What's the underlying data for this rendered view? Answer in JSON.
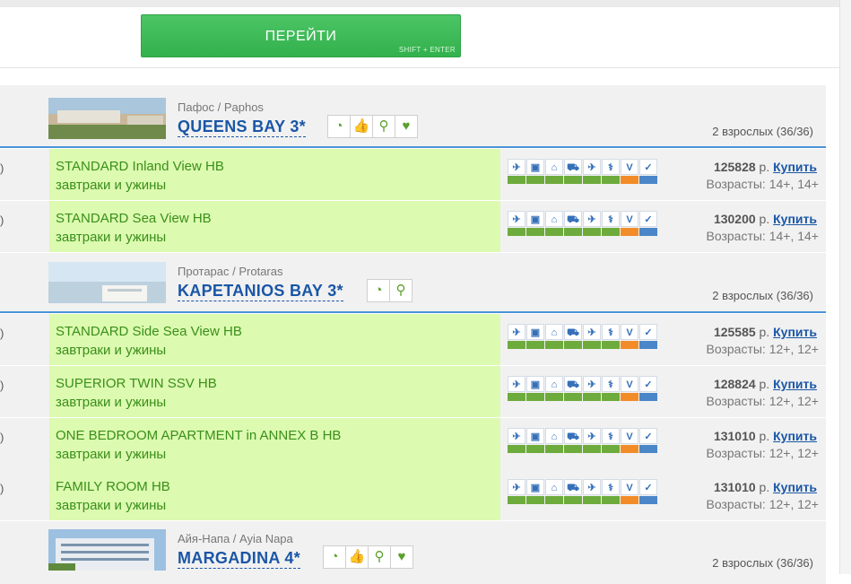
{
  "go_button": {
    "label": "ПЕРЕЙТИ",
    "hint": "SHIFT + ENTER"
  },
  "row_edge_mark": ")",
  "service_icons": [
    "plane-icon",
    "bus-icon",
    "house-icon",
    "car-icon",
    "plane2-icon",
    "medical-icon",
    "visa-icon",
    "check-icon"
  ],
  "service_bar_colors": [
    "#6dab3c",
    "#6dab3c",
    "#6dab3c",
    "#6dab3c",
    "#6dab3c",
    "#6dab3c",
    "#f28c28",
    "#4a86c8"
  ],
  "hotels": [
    {
      "location": "Пафос / Paphos",
      "name": "QUEENS BAY 3*",
      "pax": "2 взрослых (36/36)",
      "icons": [
        "pool-icon",
        "thumbs-up-icon",
        "family-icon",
        "heart-icon"
      ],
      "rooms": [
        {
          "name": "STANDARD Inland View HB",
          "meal": "завтраки и ужины",
          "price": "125828",
          "currency": " р. ",
          "buy": "Купить",
          "ages": "Возрасты: 14+, 14+"
        },
        {
          "name": "STANDARD Sea View HB",
          "meal": "завтраки и ужины",
          "price": "130200",
          "currency": " р. ",
          "buy": "Купить",
          "ages": "Возрасты: 14+, 14+"
        }
      ]
    },
    {
      "location": "Протарас / Protaras",
      "name": "KAPETANIOS BAY 3*",
      "pax": "2 взрослых (36/36)",
      "icons": [
        "pool-icon",
        "family-icon"
      ],
      "rooms": [
        {
          "name": "STANDARD Side Sea View HB",
          "meal": "завтраки и ужины",
          "price": "125585",
          "currency": " р. ",
          "buy": "Купить",
          "ages": "Возрасты: 12+, 12+"
        },
        {
          "name": "SUPERIOR TWIN SSV HB",
          "meal": "завтраки и ужины",
          "price": "128824",
          "currency": " р. ",
          "buy": "Купить",
          "ages": "Возрасты: 12+, 12+"
        },
        {
          "name": "ONE BEDROOM APARTMENT in ANNEX B HB",
          "meal": "завтраки и ужины",
          "price": "131010",
          "currency": " р. ",
          "buy": "Купить",
          "ages": "Возрасты: 12+, 12+"
        },
        {
          "name": "FAMILY ROOM HB",
          "meal": "завтраки и ужины",
          "price": "131010",
          "currency": " р. ",
          "buy": "Купить",
          "ages": "Возрасты: 12+, 12+"
        }
      ]
    },
    {
      "location": "Айя-Напа / Ayia Napa",
      "name": "MARGADINA 4*",
      "pax": "2 взрослых (36/36)",
      "icons": [
        "pool-icon",
        "thumbs-up-icon",
        "family-icon",
        "heart-icon"
      ],
      "rooms": []
    }
  ]
}
